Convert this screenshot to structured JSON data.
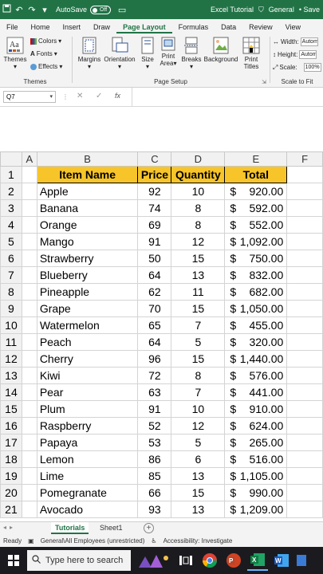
{
  "titlebar": {
    "autosave_label": "AutoSave",
    "autosave_state": "Off",
    "title": "Excel Tutorial",
    "sensitivity": "General",
    "save_status": "• Save"
  },
  "menu": [
    "File",
    "Home",
    "Insert",
    "Draw",
    "Page Layout",
    "Formulas",
    "Data",
    "Review",
    "View"
  ],
  "menu_active": "Page Layout",
  "ribbon": {
    "themes_btn": "Themes",
    "colors": "Colors",
    "fonts": "Fonts",
    "effects": "Effects",
    "themes_group": "Themes",
    "margins": "Margins",
    "orientation": "Orientation",
    "size": "Size",
    "print_area_1": "Print",
    "print_area_2": "Area",
    "breaks": "Breaks",
    "background": "Background",
    "print_titles_1": "Print",
    "print_titles_2": "Titles",
    "page_setup_group": "Page Setup",
    "width_label": "Width:",
    "width_value": "Automatic",
    "height_label": "Height:",
    "height_value": "Automatic",
    "scale_label": "Scale:",
    "scale_value": "100%",
    "scale_group": "Scale to Fit"
  },
  "formula": {
    "name_box": "Q7",
    "fx": "fx",
    "content": ""
  },
  "columns": [
    "A",
    "B",
    "C",
    "D",
    "E",
    "F"
  ],
  "header_row": {
    "row": "1",
    "name": "Item Name",
    "price": "Price",
    "qty": "Quantity",
    "total": "Total"
  },
  "rows": [
    {
      "row": "2",
      "name": "Apple",
      "price": "92",
      "qty": "10",
      "cur": "$",
      "total": "920.00"
    },
    {
      "row": "3",
      "name": "Banana",
      "price": "74",
      "qty": "8",
      "cur": "$",
      "total": "592.00"
    },
    {
      "row": "4",
      "name": "Orange",
      "price": "69",
      "qty": "8",
      "cur": "$",
      "total": "552.00"
    },
    {
      "row": "5",
      "name": "Mango",
      "price": "91",
      "qty": "12",
      "cur": "$",
      "total": "1,092.00"
    },
    {
      "row": "6",
      "name": "Strawberry",
      "price": "50",
      "qty": "15",
      "cur": "$",
      "total": "750.00"
    },
    {
      "row": "7",
      "name": "Blueberry",
      "price": "64",
      "qty": "13",
      "cur": "$",
      "total": "832.00"
    },
    {
      "row": "8",
      "name": "Pineapple",
      "price": "62",
      "qty": "11",
      "cur": "$",
      "total": "682.00"
    },
    {
      "row": "9",
      "name": "Grape",
      "price": "70",
      "qty": "15",
      "cur": "$",
      "total": "1,050.00"
    },
    {
      "row": "10",
      "name": "Watermelon",
      "price": "65",
      "qty": "7",
      "cur": "$",
      "total": "455.00"
    },
    {
      "row": "11",
      "name": "Peach",
      "price": "64",
      "qty": "5",
      "cur": "$",
      "total": "320.00"
    },
    {
      "row": "12",
      "name": "Cherry",
      "price": "96",
      "qty": "15",
      "cur": "$",
      "total": "1,440.00"
    },
    {
      "row": "13",
      "name": "Kiwi",
      "price": "72",
      "qty": "8",
      "cur": "$",
      "total": "576.00"
    },
    {
      "row": "14",
      "name": "Pear",
      "price": "63",
      "qty": "7",
      "cur": "$",
      "total": "441.00"
    },
    {
      "row": "15",
      "name": "Plum",
      "price": "91",
      "qty": "10",
      "cur": "$",
      "total": "910.00"
    },
    {
      "row": "16",
      "name": "Raspberry",
      "price": "52",
      "qty": "12",
      "cur": "$",
      "total": "624.00"
    },
    {
      "row": "17",
      "name": "Papaya",
      "price": "53",
      "qty": "5",
      "cur": "$",
      "total": "265.00"
    },
    {
      "row": "18",
      "name": "Lemon",
      "price": "86",
      "qty": "6",
      "cur": "$",
      "total": "516.00"
    },
    {
      "row": "19",
      "name": "Lime",
      "price": "85",
      "qty": "13",
      "cur": "$",
      "total": "1,105.00"
    },
    {
      "row": "20",
      "name": "Pomegranate",
      "price": "66",
      "qty": "15",
      "cur": "$",
      "total": "990.00"
    },
    {
      "row": "21",
      "name": "Avocado",
      "price": "93",
      "qty": "13",
      "cur": "$",
      "total": "1,209.00"
    }
  ],
  "tabs": {
    "active": "Tutorials",
    "other": "Sheet1",
    "add": "+"
  },
  "status": {
    "ready": "Ready",
    "sensitivity": "General\\All Employees (unrestricted)",
    "accessibility": "Accessibility: Investigate"
  },
  "taskbar": {
    "search_placeholder": "Type here to search"
  },
  "colors": {
    "excel_green": "#217346",
    "header_fill": "#f7c52a"
  }
}
